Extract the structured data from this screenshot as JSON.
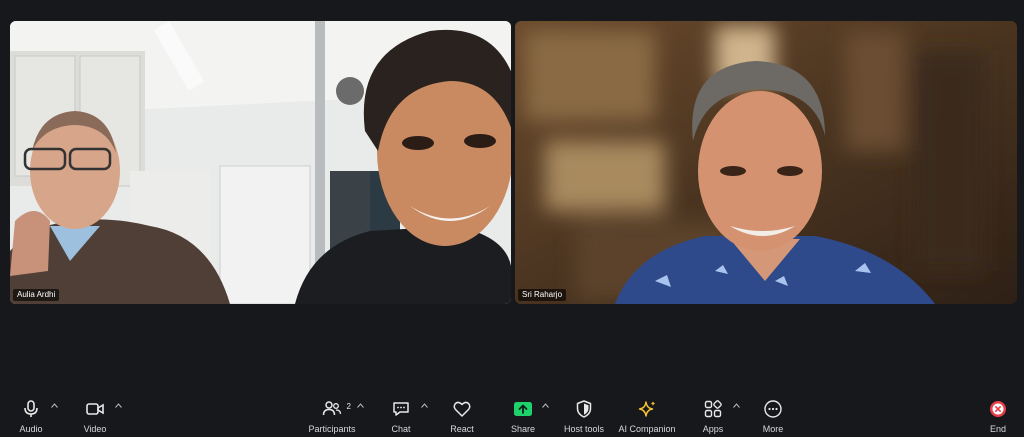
{
  "participants_tiles": [
    {
      "name": "Aulia Ardhi"
    },
    {
      "name": "Sri Raharjo"
    }
  ],
  "toolbar": {
    "audio": {
      "label": "Audio",
      "icon": "microphone-icon"
    },
    "video": {
      "label": "Video",
      "icon": "video-camera-icon"
    },
    "participants": {
      "label": "Participants",
      "count": "2",
      "icon": "participants-icon"
    },
    "chat": {
      "label": "Chat",
      "icon": "chat-icon"
    },
    "react": {
      "label": "React",
      "icon": "heart-icon"
    },
    "share": {
      "label": "Share",
      "icon": "share-arrow-icon"
    },
    "host_tools": {
      "label": "Host tools",
      "icon": "shield-icon"
    },
    "ai_companion": {
      "label": "AI Companion",
      "icon": "sparkle-icon"
    },
    "apps": {
      "label": "Apps",
      "icon": "apps-icon"
    },
    "more": {
      "label": "More",
      "icon": "more-dots-icon"
    },
    "end": {
      "label": "End",
      "icon": "end-x-icon"
    }
  },
  "colors": {
    "background": "#16181b",
    "share_green": "#1fd16a",
    "ai_yellow": "#f4c430",
    "end_red": "#e5404a"
  }
}
